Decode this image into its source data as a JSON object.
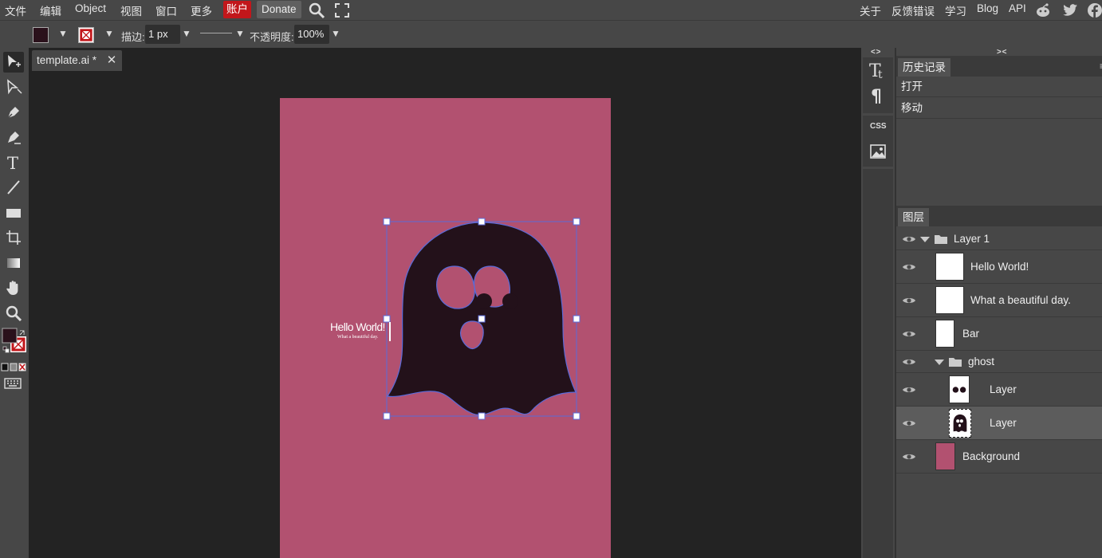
{
  "menubar": {
    "file": "文件",
    "edit": "编辑",
    "object": "Object",
    "view": "视图",
    "window": "窗口",
    "more": "更多",
    "account": "账户",
    "donate": "Donate",
    "about": "关于",
    "feedback": "反馈错误",
    "learn": "学习",
    "blog": "Blog",
    "api": "API"
  },
  "options": {
    "stroke_label": "描边:",
    "stroke_value": "1 px",
    "opacity_label": "不透明度:",
    "opacity_value": "100%",
    "fill_color": "#2a111b",
    "stroke_color": "#ffffff"
  },
  "document": {
    "tab_title": "template.ai *",
    "close_glyph": "✕",
    "artboard_color": "#b25170",
    "ghost_color": "#23111a",
    "selection_color": "#5b6bd9",
    "text_title": "Hello World!",
    "text_subtitle": "What a beautiful day."
  },
  "strip": {
    "collapse_left": "< >",
    "collapse_right": "> <",
    "css_label": "CSS"
  },
  "history": {
    "tab": "历史记录",
    "items": [
      "打开",
      "移动"
    ]
  },
  "layers": {
    "tab": "图层",
    "rows": [
      {
        "name": "Layer 1",
        "kind": "group",
        "depth": 0
      },
      {
        "name": "Hello World!",
        "kind": "layer",
        "depth": 1
      },
      {
        "name": "What a beautiful day.",
        "kind": "layer",
        "depth": 1
      },
      {
        "name": "Bar",
        "kind": "layer",
        "depth": 1
      },
      {
        "name": "ghost",
        "kind": "group",
        "depth": 1
      },
      {
        "name": "Layer",
        "kind": "layer",
        "depth": 2
      },
      {
        "name": "Layer",
        "kind": "layer",
        "depth": 2,
        "selected": true
      },
      {
        "name": "Background",
        "kind": "layer",
        "depth": 1
      }
    ]
  }
}
